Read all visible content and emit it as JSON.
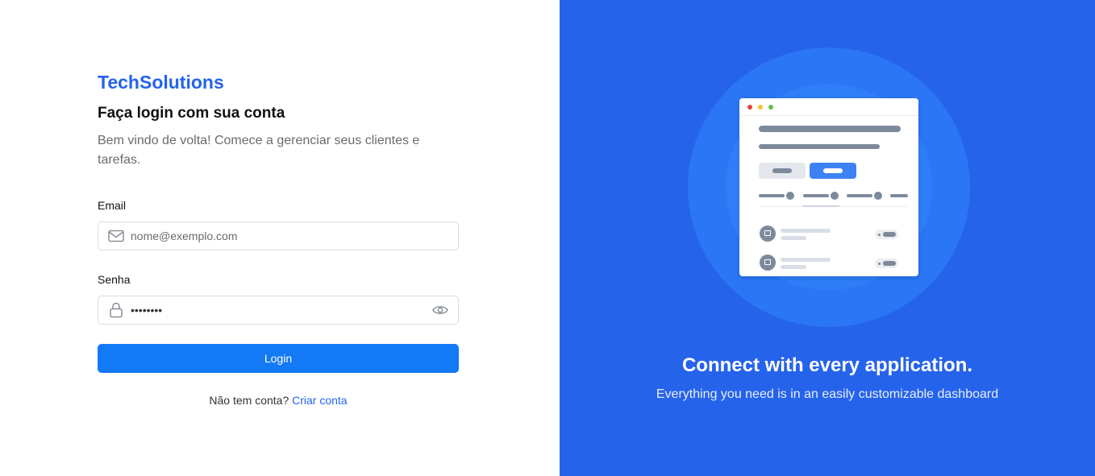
{
  "brand": "TechSolutions",
  "heading": "Faça login com sua conta",
  "subtitle": "Bem vindo de volta! Comece a gerenciar seus clientes e tarefas.",
  "email": {
    "label": "Email",
    "placeholder": "nome@exemplo.com"
  },
  "password": {
    "label": "Senha",
    "value": "••••••••"
  },
  "login_label": "Login",
  "signup": {
    "text": "Não tem conta?",
    "link": "Criar conta"
  },
  "hero": {
    "title": "Connect with every application.",
    "subtitle": "Everything you need is in an easily customizable dashboard"
  },
  "icons": [
    "mail-icon",
    "lock-icon",
    "eye-icon"
  ],
  "colors": {
    "brand": "#2563eb",
    "button": "#1479f4",
    "panel": "#2563eb"
  }
}
